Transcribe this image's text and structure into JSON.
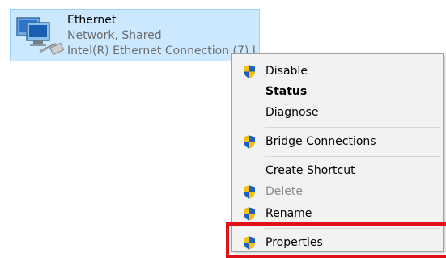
{
  "adapter": {
    "name": "Ethernet",
    "status": "Network, Shared",
    "device": "Intel(R) Ethernet Connection (7) I",
    "icon": "network-adapter-icon"
  },
  "context_menu": {
    "items": [
      {
        "label": "Disable",
        "icon": "uac-shield-icon",
        "bold": false,
        "enabled": true
      },
      {
        "label": "Status",
        "icon": null,
        "bold": true,
        "enabled": true
      },
      {
        "label": "Diagnose",
        "icon": null,
        "bold": false,
        "enabled": true
      },
      {
        "label": "Bridge Connections",
        "icon": "uac-shield-icon",
        "bold": false,
        "enabled": true
      },
      {
        "label": "Create Shortcut",
        "icon": null,
        "bold": false,
        "enabled": true
      },
      {
        "label": "Delete",
        "icon": "uac-shield-icon",
        "bold": false,
        "enabled": false
      },
      {
        "label": "Rename",
        "icon": "uac-shield-icon",
        "bold": false,
        "enabled": true
      },
      {
        "label": "Properties",
        "icon": "uac-shield-icon",
        "bold": false,
        "enabled": true
      }
    ]
  },
  "colors": {
    "selection": "#cce8ff",
    "highlight_box": "#e01018",
    "shield_blue": "#1f5fbf",
    "shield_yellow": "#f4c20d"
  }
}
